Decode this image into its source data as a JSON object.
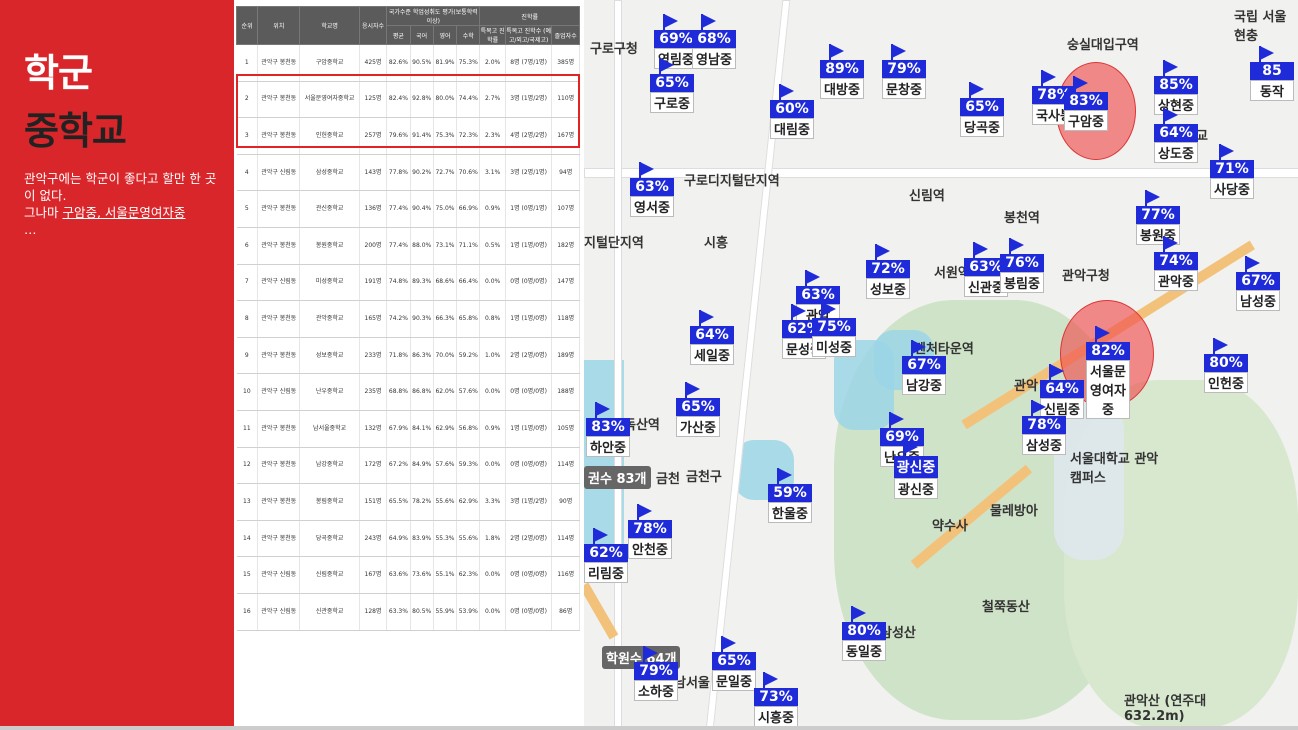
{
  "slide": {
    "title1": "학군",
    "title2": "중학교",
    "desc_line1": "관악구에는 학군이 좋다고 할만 한 곳이 없다.",
    "desc_line2_prefix": "그나마 ",
    "desc_line2_ul": "구암중, 서울문영여자중",
    "desc_line3": "…"
  },
  "table": {
    "headers": [
      "순위",
      "위치",
      "학교명",
      "응시자수",
      "국가수준 학업성취도 평가(보통학력이상)",
      "",
      "",
      "",
      "진학률",
      "",
      ""
    ],
    "subheaders": [
      "",
      "",
      "",
      "",
      "평균",
      "국어",
      "영어",
      "수학",
      "특목고 진학률",
      "특목고 진학수 (예고/외고/국제고)",
      "졸업자수"
    ],
    "rows": [
      [
        "1",
        "관악구 봉천동",
        "구암중학교",
        "425명",
        "82.6%",
        "90.5%",
        "81.9%",
        "75.3%",
        "2.0%",
        "8명 (7명/1명)",
        "385명"
      ],
      [
        "2",
        "관악구 봉천동",
        "서울문영여자중학교",
        "125명",
        "82.4%",
        "92.8%",
        "80.0%",
        "74.4%",
        "2.7%",
        "3명 (1명/2명)",
        "110명"
      ],
      [
        "3",
        "관악구 봉천동",
        "인헌중학교",
        "257명",
        "79.6%",
        "91.4%",
        "75.3%",
        "72.3%",
        "2.3%",
        "4명 (2명/2명)",
        "167명"
      ],
      [
        "4",
        "관악구 신림동",
        "삼성중학교",
        "143명",
        "77.8%",
        "90.2%",
        "72.7%",
        "70.6%",
        "3.1%",
        "3명 (2명/1명)",
        "94명"
      ],
      [
        "5",
        "관악구 봉천동",
        "관신중학교",
        "136명",
        "77.4%",
        "90.4%",
        "75.0%",
        "66.9%",
        "0.9%",
        "1명 (0명/1명)",
        "107명"
      ],
      [
        "6",
        "관악구 봉천동",
        "봉원중학교",
        "200명",
        "77.4%",
        "88.0%",
        "73.1%",
        "71.1%",
        "0.5%",
        "1명 (1명/0명)",
        "182명"
      ],
      [
        "7",
        "관악구 신림동",
        "미성중학교",
        "191명",
        "74.8%",
        "89.3%",
        "68.6%",
        "66.4%",
        "0.0%",
        "0명 (0명/0명)",
        "147명"
      ],
      [
        "8",
        "관악구 봉천동",
        "관악중학교",
        "165명",
        "74.2%",
        "90.3%",
        "66.3%",
        "65.8%",
        "0.8%",
        "1명 (1명/0명)",
        "118명"
      ],
      [
        "9",
        "관악구 봉천동",
        "성보중학교",
        "233명",
        "71.8%",
        "86.3%",
        "70.0%",
        "59.2%",
        "1.0%",
        "2명 (2명/0명)",
        "189명"
      ],
      [
        "10",
        "관악구 신림동",
        "난우중학교",
        "235명",
        "68.8%",
        "86.8%",
        "62.0%",
        "57.6%",
        "0.0%",
        "0명 (0명/0명)",
        "188명"
      ],
      [
        "11",
        "관악구 봉천동",
        "남서울중학교",
        "132명",
        "67.9%",
        "84.1%",
        "62.9%",
        "56.8%",
        "0.9%",
        "1명 (1명/0명)",
        "105명"
      ],
      [
        "12",
        "관악구 봉천동",
        "남강중학교",
        "172명",
        "67.2%",
        "84.9%",
        "57.6%",
        "59.3%",
        "0.0%",
        "0명 (0명/0명)",
        "114명"
      ],
      [
        "13",
        "관악구 봉천동",
        "봉림중학교",
        "151명",
        "65.5%",
        "78.2%",
        "55.6%",
        "62.9%",
        "3.3%",
        "3명 (1명/2명)",
        "90명"
      ],
      [
        "14",
        "관악구 봉천동",
        "당곡중학교",
        "243명",
        "64.9%",
        "83.9%",
        "55.3%",
        "55.6%",
        "1.8%",
        "2명 (2명/0명)",
        "114명"
      ],
      [
        "15",
        "관악구 신림동",
        "신림중학교",
        "167명",
        "63.6%",
        "73.6%",
        "55.1%",
        "62.3%",
        "0.0%",
        "0명 (0명/0명)",
        "116명"
      ],
      [
        "16",
        "관악구 신림동",
        "신관중학교",
        "128명",
        "63.3%",
        "80.5%",
        "55.9%",
        "53.9%",
        "0.0%",
        "0명 (0명/0명)",
        "86명"
      ]
    ]
  },
  "map": {
    "places": [
      "구로구청",
      "구로디지털단지역",
      "시흥",
      "신림역",
      "관악구청",
      "숭실대입구역",
      "서울대학교 관악캠퍼스",
      "약수사",
      "물레방아",
      "철쭉동산",
      "삼성산",
      "금천",
      "남서울",
      "독산역",
      "지털단지역",
      "관악산 (연주대632.2m)",
      "국립 서울현충",
      "서원역",
      "봉천역",
      "학교",
      "벤처타운역",
      "관악",
      "낙",
      "금천구",
      "시흥"
    ],
    "markers": [
      {
        "pct": "69%",
        "name": "영림중"
      },
      {
        "pct": "68%",
        "name": "영남중"
      },
      {
        "pct": "65%",
        "name": "구로중"
      },
      {
        "pct": "89%",
        "name": "대방중"
      },
      {
        "pct": "79%",
        "name": "문창중"
      },
      {
        "pct": "60%",
        "name": "대림중"
      },
      {
        "pct": "65%",
        "name": "당곡중"
      },
      {
        "pct": "78%",
        "name": "국사봉"
      },
      {
        "pct": "83%",
        "name": "구암중"
      },
      {
        "pct": "85%",
        "name": "상현중"
      },
      {
        "pct": "64%",
        "name": "상도중"
      },
      {
        "pct": "85",
        "name": "동작"
      },
      {
        "pct": "71%",
        "name": "사당중"
      },
      {
        "pct": "63%",
        "name": "영서중"
      },
      {
        "pct": "77%",
        "name": "봉원중"
      },
      {
        "pct": "72%",
        "name": "성보중"
      },
      {
        "pct": "63%",
        "name": "신관중"
      },
      {
        "pct": "76%",
        "name": "봉림중"
      },
      {
        "pct": "74%",
        "name": "관악중"
      },
      {
        "pct": "67%",
        "name": "남성중"
      },
      {
        "pct": "63%",
        "name": "관악"
      },
      {
        "pct": "62%",
        "name": "문성중"
      },
      {
        "pct": "75%",
        "name": "미성중"
      },
      {
        "pct": "64%",
        "name": "세일중"
      },
      {
        "pct": "67%",
        "name": "남강중"
      },
      {
        "pct": "82%",
        "name": "서울문영여자중"
      },
      {
        "pct": "80%",
        "name": "인헌중"
      },
      {
        "pct": "64%",
        "name": "신림중"
      },
      {
        "pct": "65%",
        "name": "가산중"
      },
      {
        "pct": "83%",
        "name": "하안중"
      },
      {
        "pct": "69%",
        "name": "난우중"
      },
      {
        "pct": "78%",
        "name": "삼성중"
      },
      {
        "pct": "광신중",
        "name": "광신중"
      },
      {
        "pct": "59%",
        "name": "한울중"
      },
      {
        "pct": "78%",
        "name": "안천중"
      },
      {
        "pct": "62%",
        "name": "리림중"
      },
      {
        "pct": "80%",
        "name": "동일중"
      },
      {
        "pct": "65%",
        "name": "문일중"
      },
      {
        "pct": "79%",
        "name": "소하중"
      },
      {
        "pct": "73%",
        "name": "시흥중"
      }
    ],
    "grey_labels": [
      "권수 83개",
      "학원수 64개"
    ]
  },
  "colors": {
    "accent": "#d8262a",
    "marker": "#1f2bd8",
    "highlight": "#e02424"
  }
}
